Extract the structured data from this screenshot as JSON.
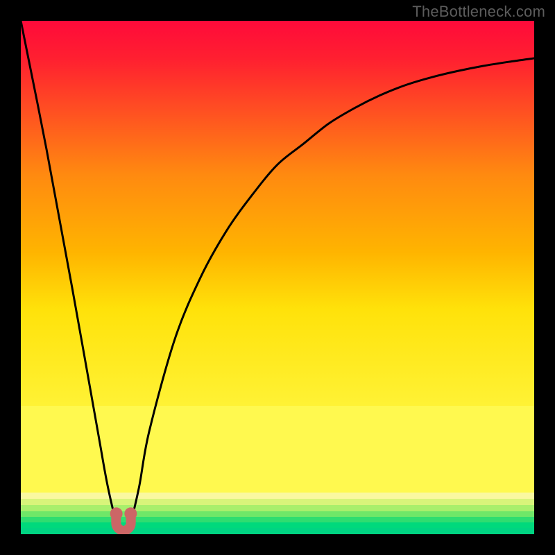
{
  "watermark": "TheBottleneck.com",
  "chart_data": {
    "type": "line",
    "title": "",
    "xlabel": "",
    "ylabel": "",
    "xlim": [
      0,
      100
    ],
    "ylim": [
      0,
      100
    ],
    "grid": false,
    "series": [
      {
        "name": "bottleneck-curve",
        "x": [
          0,
          5,
          10,
          15,
          17,
          19,
          20,
          21,
          23,
          25,
          30,
          35,
          40,
          45,
          50,
          55,
          60,
          65,
          70,
          75,
          80,
          85,
          90,
          95,
          100
        ],
        "values": [
          100,
          75,
          48,
          20,
          9,
          1,
          0,
          1,
          9,
          20,
          38,
          50,
          59,
          66,
          72,
          76,
          80,
          83,
          85.5,
          87.5,
          89,
          90.2,
          91.2,
          92,
          92.7
        ]
      }
    ],
    "marker": {
      "name": "optimal-u-marker",
      "color": "#cc6666",
      "x": [
        18.6,
        18.6,
        19.3,
        20.0,
        20.7,
        21.4,
        21.4
      ],
      "y": [
        4.0,
        1.8,
        0.9,
        0.7,
        0.9,
        1.8,
        4.0
      ]
    },
    "gradient_bands": [
      {
        "y_start": 100,
        "y_end": 25,
        "from": "#ff0a3a",
        "to": "#ffce00",
        "note": "upper red-to-yellow gradient"
      },
      {
        "y_start": 25,
        "y_end": 8,
        "color": "#fff94f",
        "note": "pale yellow band"
      },
      {
        "y_start": 8,
        "y_end": 0,
        "stripes": [
          "#faf8a0",
          "#d8f47a",
          "#a8ef6c",
          "#6fe768",
          "#2fdd70",
          "#00d97c",
          "#00d482"
        ],
        "note": "thin green stripes"
      }
    ]
  }
}
